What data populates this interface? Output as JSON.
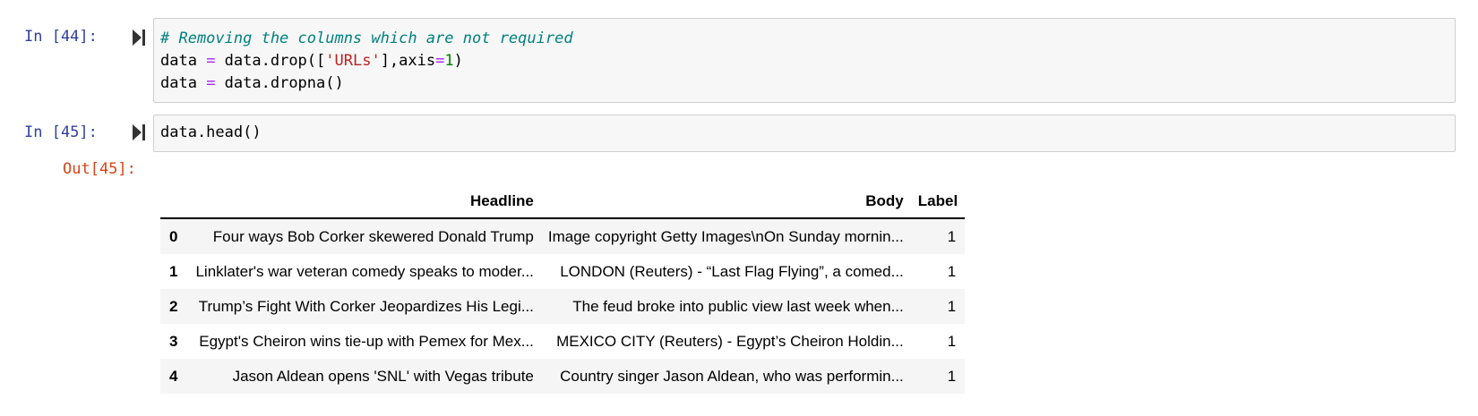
{
  "cells": [
    {
      "prompt": "In [44]:",
      "code_lines": [
        {
          "tokens": [
            {
              "t": "comment",
              "v": "# Removing the columns which are not required"
            }
          ]
        },
        {
          "tokens": [
            {
              "t": "plain",
              "v": "data "
            },
            {
              "t": "op",
              "v": "="
            },
            {
              "t": "plain",
              "v": " data.drop(["
            },
            {
              "t": "str",
              "v": "'URLs'"
            },
            {
              "t": "plain",
              "v": "],axis"
            },
            {
              "t": "op",
              "v": "="
            },
            {
              "t": "num",
              "v": "1"
            },
            {
              "t": "plain",
              "v": ")"
            }
          ]
        },
        {
          "tokens": [
            {
              "t": "plain",
              "v": "data "
            },
            {
              "t": "op",
              "v": "="
            },
            {
              "t": "plain",
              "v": " data.dropna()"
            }
          ]
        }
      ]
    },
    {
      "prompt": "In [45]:",
      "code_lines": [
        {
          "tokens": [
            {
              "t": "plain",
              "v": "data.head()"
            }
          ]
        }
      ],
      "out_prompt": "Out[45]:"
    }
  ],
  "dataframe": {
    "columns": [
      "Headline",
      "Body",
      "Label"
    ],
    "rows": [
      {
        "index": "0",
        "Headline": "Four ways Bob Corker skewered Donald Trump",
        "Body": "Image copyright Getty Images\\nOn Sunday mornin...",
        "Label": "1"
      },
      {
        "index": "1",
        "Headline": "Linklater's war veteran comedy speaks to moder...",
        "Body": "LONDON (Reuters) - “Last Flag Flying”, a comed...",
        "Label": "1"
      },
      {
        "index": "2",
        "Headline": "Trump’s Fight With Corker Jeopardizes His Legi...",
        "Body": "The feud broke into public view last week when...",
        "Label": "1"
      },
      {
        "index": "3",
        "Headline": "Egypt's Cheiron wins tie-up with Pemex for Mex...",
        "Body": "MEXICO CITY (Reuters) - Egypt’s Cheiron Holdin...",
        "Label": "1"
      },
      {
        "index": "4",
        "Headline": "Jason Aldean opens 'SNL' with Vegas tribute",
        "Body": "Country singer Jason Aldean, who was performin...",
        "Label": "1"
      }
    ]
  },
  "icons": {
    "run": "run-cell-icon"
  },
  "colors": {
    "prompt_in": "#303f9f",
    "prompt_out": "#d84315",
    "cell_bg": "#f7f7f7"
  }
}
